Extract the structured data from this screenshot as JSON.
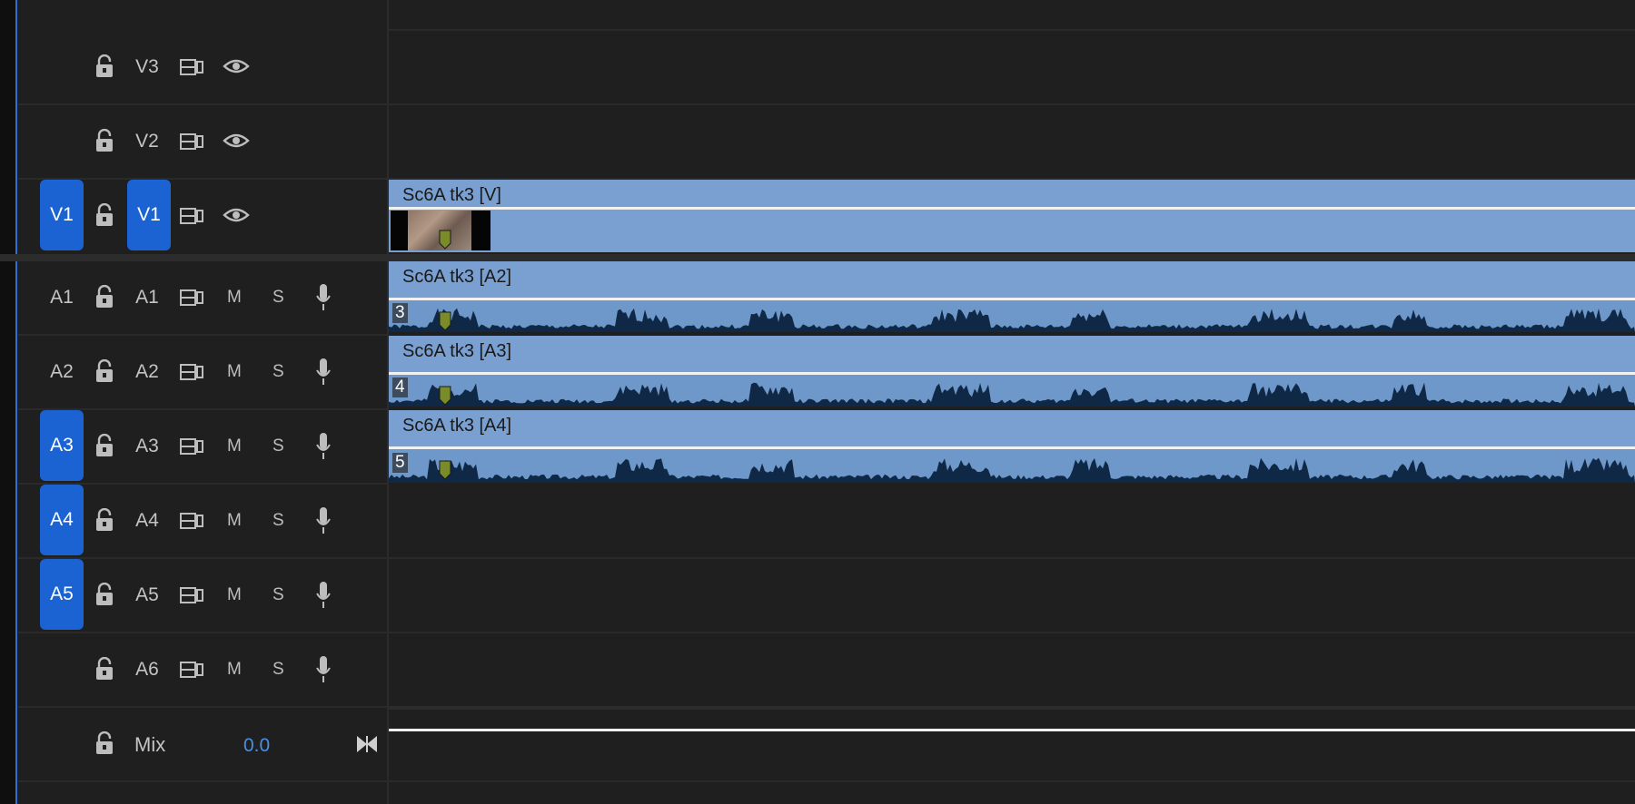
{
  "tracks": {
    "v3": {
      "label": "V3"
    },
    "v2": {
      "label": "V2"
    },
    "v1": {
      "source": "V1",
      "label": "V1"
    },
    "a1": {
      "source": "A1",
      "label": "A1"
    },
    "a2": {
      "source": "A2",
      "label": "A2"
    },
    "a3": {
      "source": "A3",
      "label": "A3"
    },
    "a4": {
      "source": "A4",
      "label": "A4"
    },
    "a5": {
      "source": "A5",
      "label": "A5"
    },
    "a6": {
      "label": "A6"
    },
    "mute_label": "M",
    "solo_label": "S"
  },
  "mix": {
    "label": "Mix",
    "value": "0.0"
  },
  "clips": {
    "v": {
      "name": "Sc6A tk3 [V]"
    },
    "a2": {
      "name": "Sc6A tk3 [A2]",
      "channel": "3"
    },
    "a3": {
      "name": "Sc6A tk3 [A3]",
      "channel": "4"
    },
    "a4": {
      "name": "Sc6A tk3 [A4]",
      "channel": "5"
    }
  },
  "colors": {
    "accent": "#1b63d3",
    "clip": "#7aa0d1",
    "waveform": "#0f2845",
    "marker": "#7a8b2a",
    "mix_value": "#4a90e2"
  }
}
